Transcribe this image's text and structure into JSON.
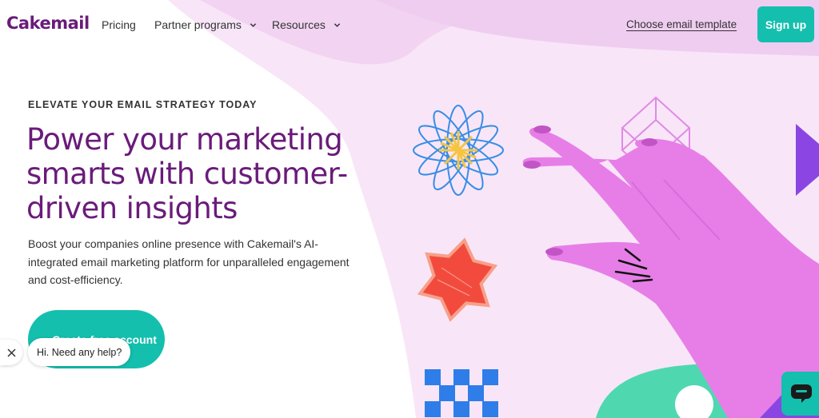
{
  "header": {
    "logo": "Cakemail",
    "nav": [
      {
        "label": "Pricing",
        "has_dropdown": false
      },
      {
        "label": "Partner programs",
        "has_dropdown": true
      },
      {
        "label": "Resources",
        "has_dropdown": true
      }
    ],
    "template_link": "Choose email template",
    "signup_label": "Sign up"
  },
  "hero": {
    "eyebrow": "ELEVATE YOUR EMAIL STRATEGY TODAY",
    "title": "Power your marketing smarts with customer-driven insights",
    "description": "Boost your companies online presence with Cakemail's AI-integrated email marketing platform for unparalleled engagement and cost-efficiency.",
    "cta_label": "Create free account"
  },
  "chat": {
    "bubble_text": "Hi. Need any help?",
    "close_icon": "close-icon",
    "launcher_icon": "chat-icon"
  },
  "colors": {
    "brand": "#6a1b7a",
    "accent": "#14bfae",
    "hand": "#e77ee8",
    "pink_bg": "#f7e1f6"
  }
}
